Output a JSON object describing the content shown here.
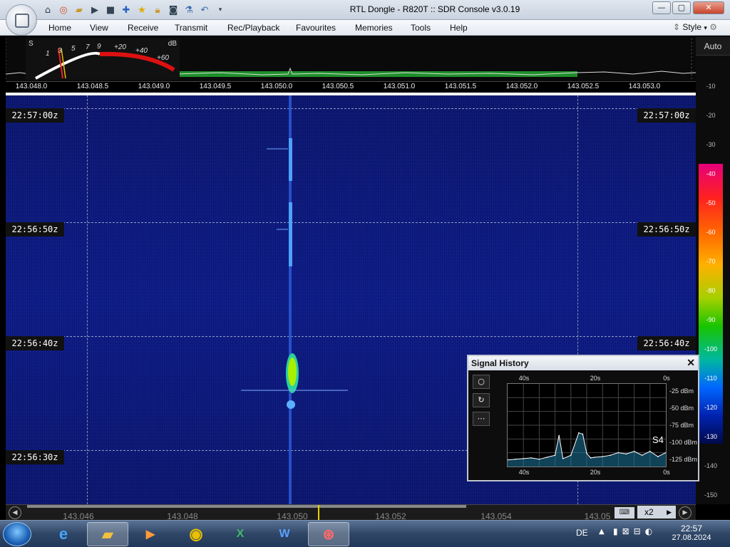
{
  "window": {
    "title": "RTL Dongle - R820T :: SDR Console v3.0.19",
    "minimize": "—",
    "maximize": "▢",
    "close": "✕"
  },
  "quick_access": [
    "home-icon",
    "lifebuoy-icon",
    "folder-icon",
    "play-icon",
    "stop-icon",
    "plus-icon",
    "star-icon",
    "lock-icon",
    "camera-icon",
    "flask-icon",
    "undo-icon",
    "dropdown-icon"
  ],
  "menu": {
    "items": [
      "Home",
      "View",
      "Receive",
      "Transmit",
      "Rec/Playback",
      "Favourites",
      "Memories",
      "Tools",
      "Help"
    ],
    "style_label": "Style"
  },
  "smeter": {
    "s_label": "S",
    "db_label": "dB",
    "s_ticks": [
      "1",
      "3",
      "5",
      "7",
      "9"
    ],
    "db_ticks": [
      "+20",
      "+40",
      "+60"
    ]
  },
  "auto_label": "Auto",
  "freq_scale": [
    "143.048.0",
    "143.048.5",
    "143.049.0",
    "143.049.5",
    "143.050.0",
    "143.050.5",
    "143.051.0",
    "143.051.5",
    "143.052.0",
    "143.052.5",
    "143.053.0"
  ],
  "waterfall": {
    "timestamps": [
      "22:57:00z",
      "22:56:50z",
      "22:56:40z",
      "22:56:30z"
    ]
  },
  "dbm_scale": [
    "-10",
    "-20",
    "-30",
    "-40",
    "-50",
    "-60",
    "-70",
    "-80",
    "-90",
    "-100",
    "-110",
    "-120",
    "-130",
    "-140",
    "-150"
  ],
  "bottom_scale": [
    "143.046",
    "143.048",
    "143.050",
    "143.052",
    "143.054",
    "143.05"
  ],
  "zoom_label": "x2",
  "signal_history": {
    "title": "Signal History",
    "close": "✕",
    "buttons": [
      "○",
      "↻",
      "⋯"
    ],
    "x_ticks": [
      "40s",
      "20s",
      "0s"
    ],
    "y_ticks": [
      "-25 dBm",
      "-50 dBm",
      "-75 dBm",
      "-100 dBm",
      "-125 dBm"
    ],
    "s_reading": "S4",
    "chart_data": {
      "type": "line",
      "x": [
        40,
        38,
        36,
        34,
        32,
        30,
        28,
        27,
        26,
        24,
        22,
        21,
        20,
        19,
        18,
        16,
        14,
        12,
        10,
        8,
        6,
        4,
        2,
        0
      ],
      "y": [
        -125,
        -124,
        -123,
        -122,
        -124,
        -121,
        -118,
        -88,
        -123,
        -118,
        -84,
        -86,
        -115,
        -122,
        -121,
        -120,
        -118,
        -114,
        -116,
        -112,
        -118,
        -112,
        -120,
        -114
      ],
      "xlim": [
        40,
        0
      ],
      "ylim": [
        -135,
        -10
      ]
    }
  },
  "taskbar": {
    "apps": [
      "ie-icon",
      "explorer-icon",
      "media-icon",
      "chrome-icon",
      "excel-icon",
      "word-icon",
      "sdr-console-icon"
    ],
    "language": "DE",
    "time": "22:57",
    "date": "27.08.2024"
  }
}
